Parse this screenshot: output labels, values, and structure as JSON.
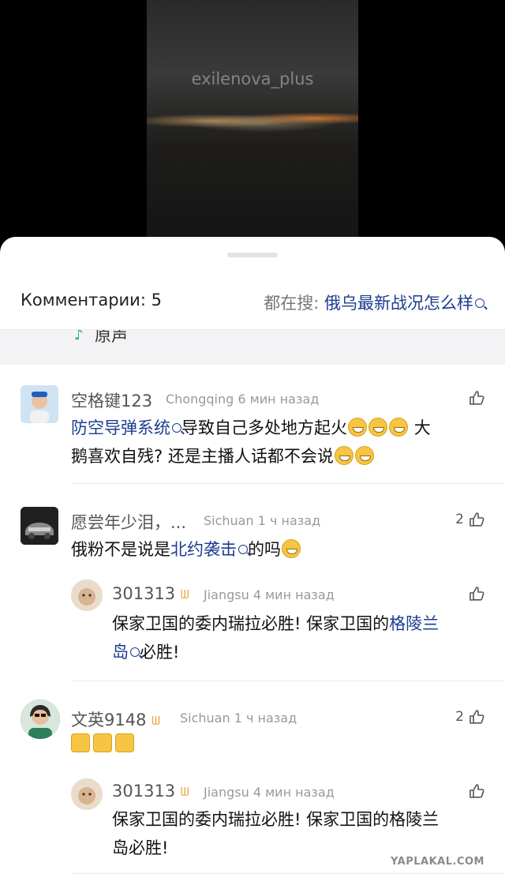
{
  "video": {
    "watermark": "exilenova_plus"
  },
  "header": {
    "comments_label": "Комментарии: 5",
    "search_prefix": "都在搜: ",
    "search_keyword": "俄乌最新战况怎么样"
  },
  "band": {
    "text": "原声"
  },
  "comments": [
    {
      "user": "空格键123",
      "location": "Chongqing",
      "time": "6 мин назад",
      "likes": "",
      "text_link": "防空导弹系统",
      "text_rest": "导致自己多处地方起火",
      "text_line2_a": "大",
      "text_line2": "鹅喜欢自残? 还是主播人话都不会说"
    },
    {
      "user": "愿尝年少泪，...",
      "location": "Sichuan",
      "time": "1 ч назад",
      "likes": "2",
      "text_a": "俄粉不是说是",
      "text_link": "北约袭击",
      "text_b": "的吗",
      "reply": {
        "user": "301313",
        "location": "Jiangsu",
        "time": "4 мин назад",
        "text_a": "保家卫国的委内瑞拉必胜! 保家卫国的",
        "text_link1": "格陵兰",
        "text_link2": "岛",
        "text_b": "必胜!"
      }
    },
    {
      "user": "文英9148",
      "location": "Sichuan",
      "time": "1 ч назад",
      "likes": "2",
      "reply": {
        "user": "301313",
        "location": "Jiangsu",
        "time": "4 мин назад",
        "text_line1": "保家卫国的委内瑞拉必胜! 保家卫国的格陵兰",
        "text_line2": "岛必胜!"
      }
    }
  ],
  "footer": {
    "watermark": "YAPLAKAL.COM"
  }
}
